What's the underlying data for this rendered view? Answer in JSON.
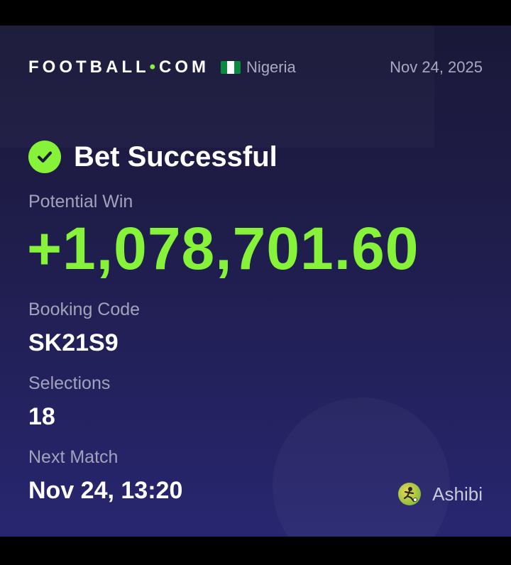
{
  "header": {
    "brand_left": "FOOTBALL",
    "brand_dot": "•",
    "brand_right": "COM",
    "country": "Nigeria",
    "date": "Nov 24, 2025"
  },
  "status": {
    "text": "Bet Successful",
    "icon": "check-circle-icon"
  },
  "potential_win": {
    "label": "Potential Win",
    "value": "+1,078,701.60"
  },
  "booking_code": {
    "label": "Booking Code",
    "value": "SK21S9"
  },
  "selections": {
    "label": "Selections",
    "value": "18"
  },
  "next_match": {
    "label": "Next Match",
    "value": "Nov 24, 13:20"
  },
  "user": {
    "name": "Ashibi",
    "avatar_icon": "football-player-avatar"
  },
  "colors": {
    "accent": "#86f23a",
    "background": "#1f1d4a",
    "label": "#a2a3bb",
    "text": "#ffffff"
  }
}
